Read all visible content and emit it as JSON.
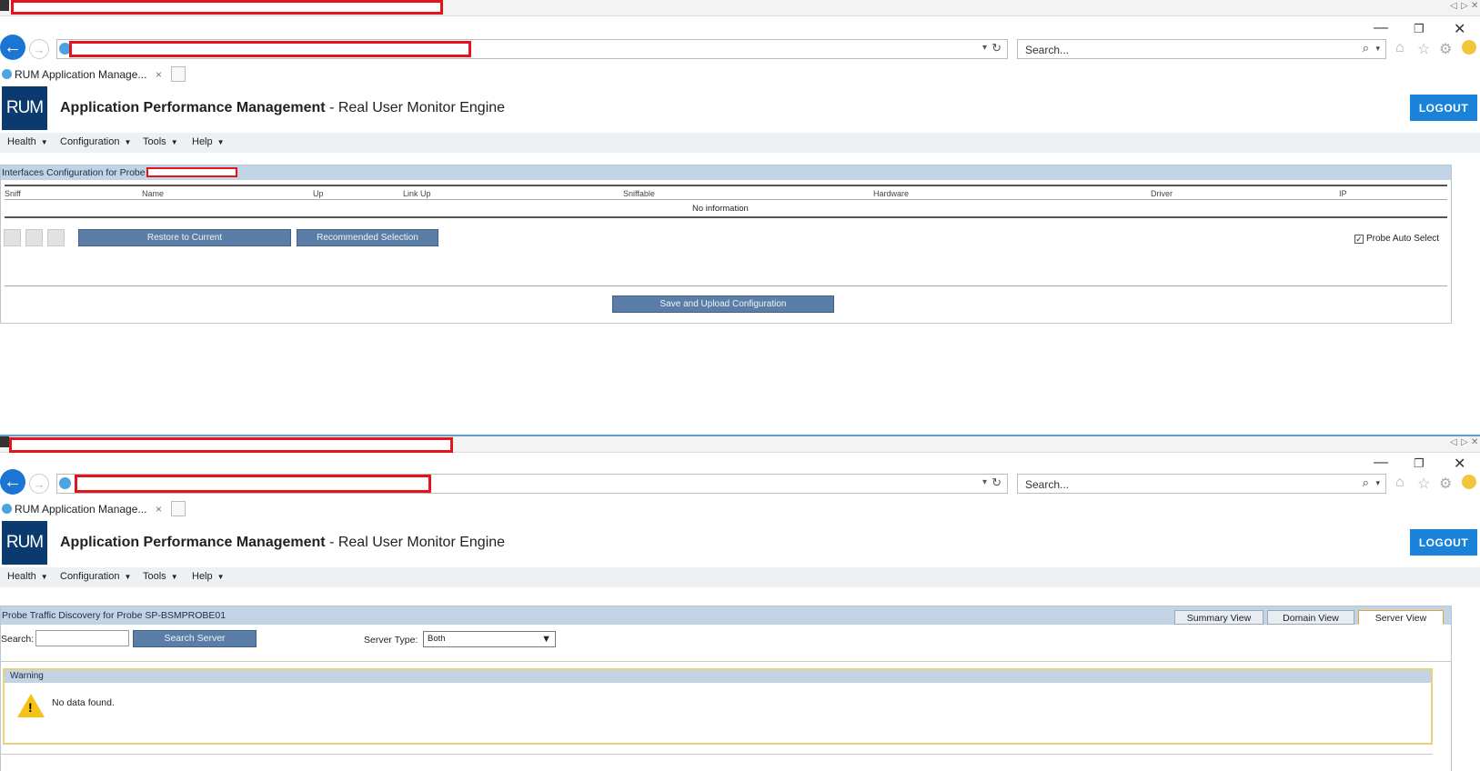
{
  "browser": {
    "search_placeholder": "Search...",
    "tab_title": "RUM Application Manage...",
    "tab_close": "×",
    "win_min": "—",
    "win_restore": "❐",
    "win_close": "✕",
    "back_glyph": "←",
    "fwd_glyph": "→"
  },
  "app": {
    "logo": "RUM",
    "title_bold": "Application Performance Management",
    "title_rest": " - Real User Monitor Engine",
    "logout": "LOGOUT",
    "menu": [
      {
        "label": "Health"
      },
      {
        "label": "Configuration"
      },
      {
        "label": "Tools"
      },
      {
        "label": "Help"
      }
    ]
  },
  "interfaces": {
    "header": "Interfaces Configuration for Probe",
    "columns": [
      "Sniff",
      "Name",
      "Up",
      "Link Up",
      "Sniffable",
      "Hardware",
      "Driver",
      "IP"
    ],
    "empty": "No information",
    "restore_btn": "Restore to Current",
    "recommended_btn": "Recommended Selection",
    "auto_select": "Probe Auto Select",
    "save_btn": "Save and Upload Configuration"
  },
  "discovery": {
    "header": "Probe Traffic Discovery for Probe SP-BSMPROBE01",
    "views": [
      "Summary View",
      "Domain View",
      "Server View"
    ],
    "active_view": "Server View",
    "search_label": "Search:",
    "search_value": "",
    "search_btn": "Search Server",
    "server_type_label": "Server Type:",
    "server_type_value": "Both",
    "warning_title": "Warning",
    "warning_text": "No data found."
  }
}
